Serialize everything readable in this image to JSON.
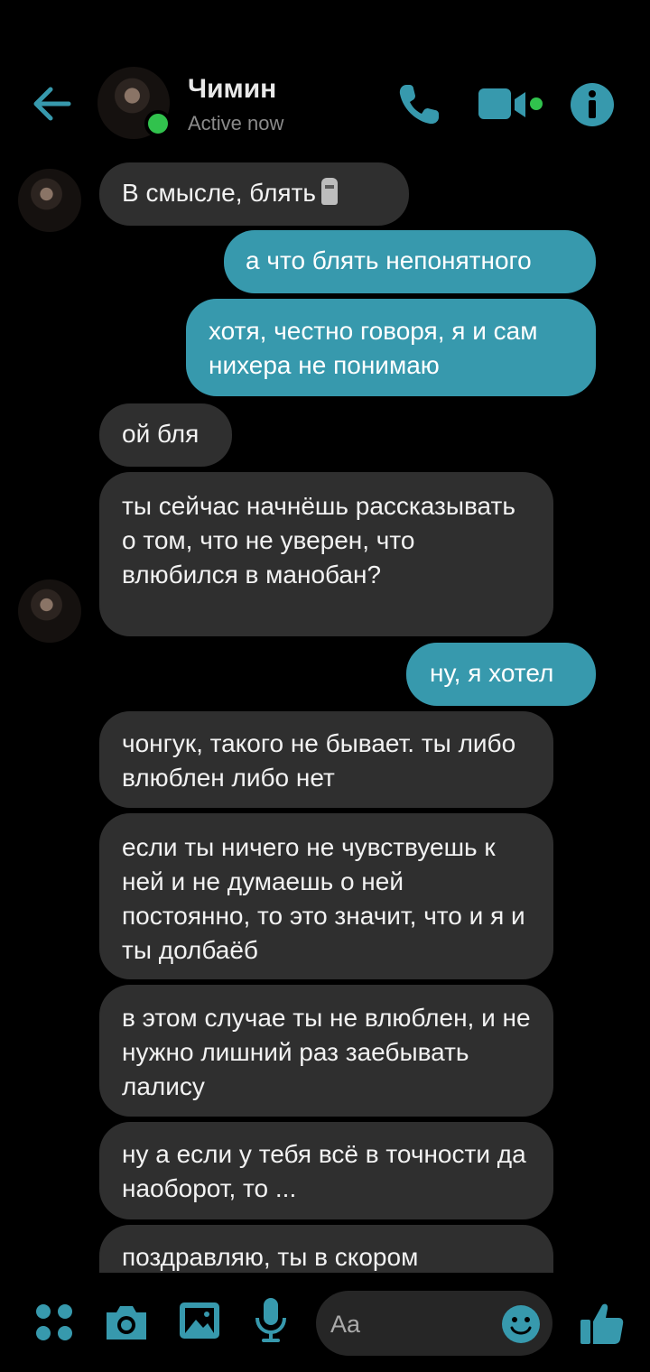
{
  "header": {
    "name": "Чимин",
    "status": "Active now"
  },
  "colors": {
    "accent": "#3799ad",
    "incoming_bubble": "#2f2f2f",
    "online": "#31c24d"
  },
  "messages": [
    {
      "from": "them",
      "text": "В смысле, блять",
      "emoji": "moai-icon"
    },
    {
      "from": "me",
      "text": "а что блять непонятного"
    },
    {
      "from": "me",
      "text": "хотя, честно говоря, я и сам нихера не понимаю"
    },
    {
      "from": "them",
      "text": "ой бля"
    },
    {
      "from": "them",
      "text": "ты сейчас начнёшь рассказывать о том, что не уверен, что влюбился в манобан?"
    },
    {
      "from": "me",
      "text": "ну, я хотел"
    },
    {
      "from": "them",
      "text": "чонгук, такого не бывает. ты либо влюблен либо нет"
    },
    {
      "from": "them",
      "text": "если ты ничего не чувствуешь к ней и не думаешь о ней постоянно, то это значит, что и я и ты долбаёб"
    },
    {
      "from": "them",
      "text": "в этом случае ты не влюблен, и не нужно лишний раз заебывать лалису"
    },
    {
      "from": "them",
      "text": "ну а если у тебя всё в точности да наоборот, то ..."
    },
    {
      "from": "them",
      "text": "поздравляю, ты в скором"
    }
  ],
  "composer": {
    "placeholder": "Aa",
    "icons": [
      "apps-icon",
      "camera-icon",
      "gallery-icon",
      "microphone-icon",
      "emoji-icon",
      "thumbs-up-icon"
    ]
  }
}
